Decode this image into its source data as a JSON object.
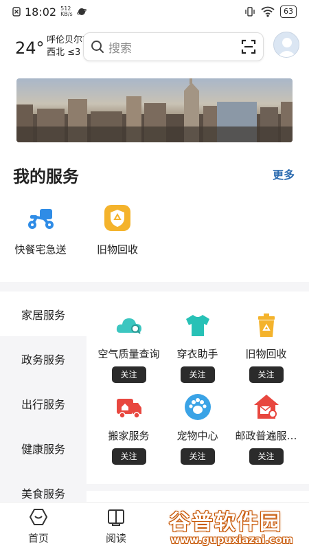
{
  "status_bar": {
    "time": "18:02",
    "net_speed_value": "512",
    "net_speed_unit": "KB/s",
    "battery": "63"
  },
  "header": {
    "temperature": "24°",
    "city": "呼伦贝尔市",
    "wind": "西北 ≤3",
    "search_placeholder": "搜索"
  },
  "my_services": {
    "title": "我的服务",
    "more_label": "更多",
    "items": [
      {
        "label": "快餐宅急送",
        "icon": "scooter-icon"
      },
      {
        "label": "旧物回收",
        "icon": "recycle-badge-icon"
      }
    ]
  },
  "categories": [
    {
      "label": "家居服务",
      "active": true
    },
    {
      "label": "政务服务",
      "active": false
    },
    {
      "label": "出行服务",
      "active": false
    },
    {
      "label": "健康服务",
      "active": false
    },
    {
      "label": "美食服务",
      "active": false
    }
  ],
  "grid": {
    "follow_label": "关注",
    "items": [
      {
        "label": "空气质量查询",
        "icon": "cloud-search-icon",
        "color": "#3cc6c0"
      },
      {
        "label": "穿衣助手",
        "icon": "tshirt-icon",
        "color": "#27c1b6"
      },
      {
        "label": "旧物回收",
        "icon": "recycle-bin-icon",
        "color": "#f4b32c"
      },
      {
        "label": "搬家服务",
        "icon": "truck-icon",
        "color": "#e8473f"
      },
      {
        "label": "宠物中心",
        "icon": "paw-icon",
        "color": "#3aa3e6"
      },
      {
        "label": "邮政普遍服…",
        "icon": "mail-house-icon",
        "color": "#e8473f"
      }
    ]
  },
  "bottom_nav": {
    "tabs": [
      {
        "label": "首页",
        "icon": "home-icon"
      },
      {
        "label": "阅读",
        "icon": "book-icon"
      }
    ]
  },
  "watermark": {
    "brand": "谷普软件园",
    "url": "www.gupuxiazai.com"
  },
  "colors": {
    "accent": "#2d6cb0",
    "button_dark": "#2b2b2b",
    "side_bg": "#f5f5f7"
  }
}
